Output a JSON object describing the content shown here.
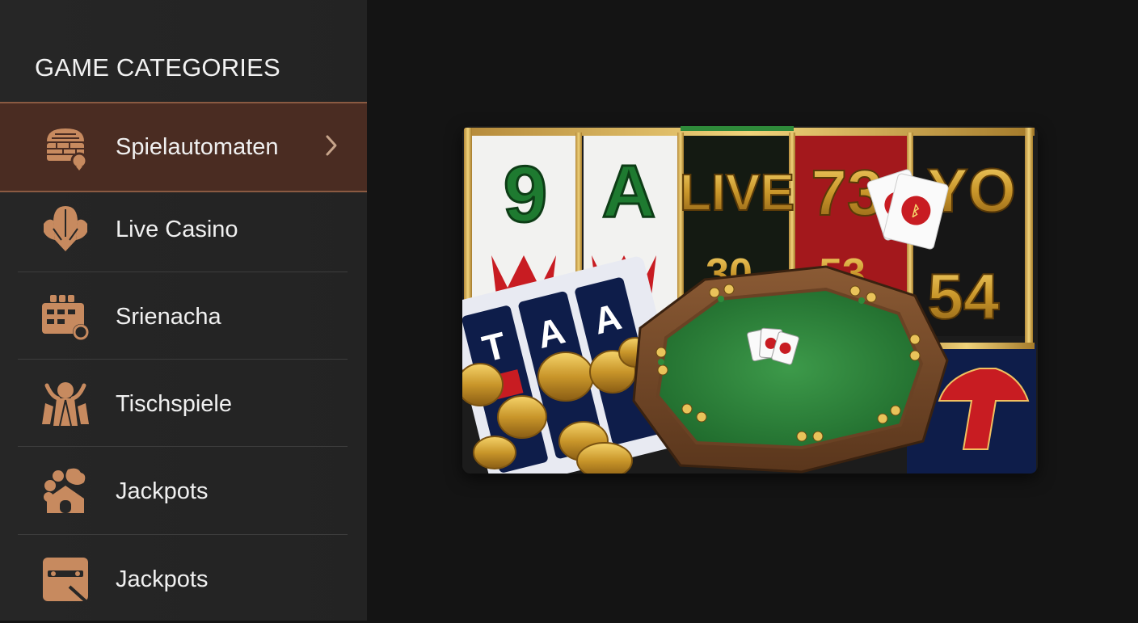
{
  "sidebar": {
    "title": "GAME CATEGORIES",
    "items": [
      {
        "label": "Spielautomaten",
        "icon": "slot-machine-icon",
        "active": true
      },
      {
        "label": "Live Casino",
        "icon": "live-dealer-icon",
        "active": false
      },
      {
        "label": "Srienacha",
        "icon": "calendar-game-icon",
        "active": false
      },
      {
        "label": "Tischspiele",
        "icon": "table-games-icon",
        "active": false
      },
      {
        "label": "Jackpots",
        "icon": "jackpot-bag-icon",
        "active": false
      },
      {
        "label": "Jackpots",
        "icon": "card-ticket-icon",
        "active": false
      }
    ]
  },
  "banner": {
    "reel_symbols": [
      "9",
      "A",
      "LIVE",
      "73",
      "YO",
      "54"
    ],
    "card_letters": [
      "T",
      "A",
      "A"
    ]
  },
  "colors": {
    "accent": "#c78a5f",
    "active_bg": "#4a2c22",
    "sidebar_bg": "#242424",
    "main_bg": "#141414"
  }
}
